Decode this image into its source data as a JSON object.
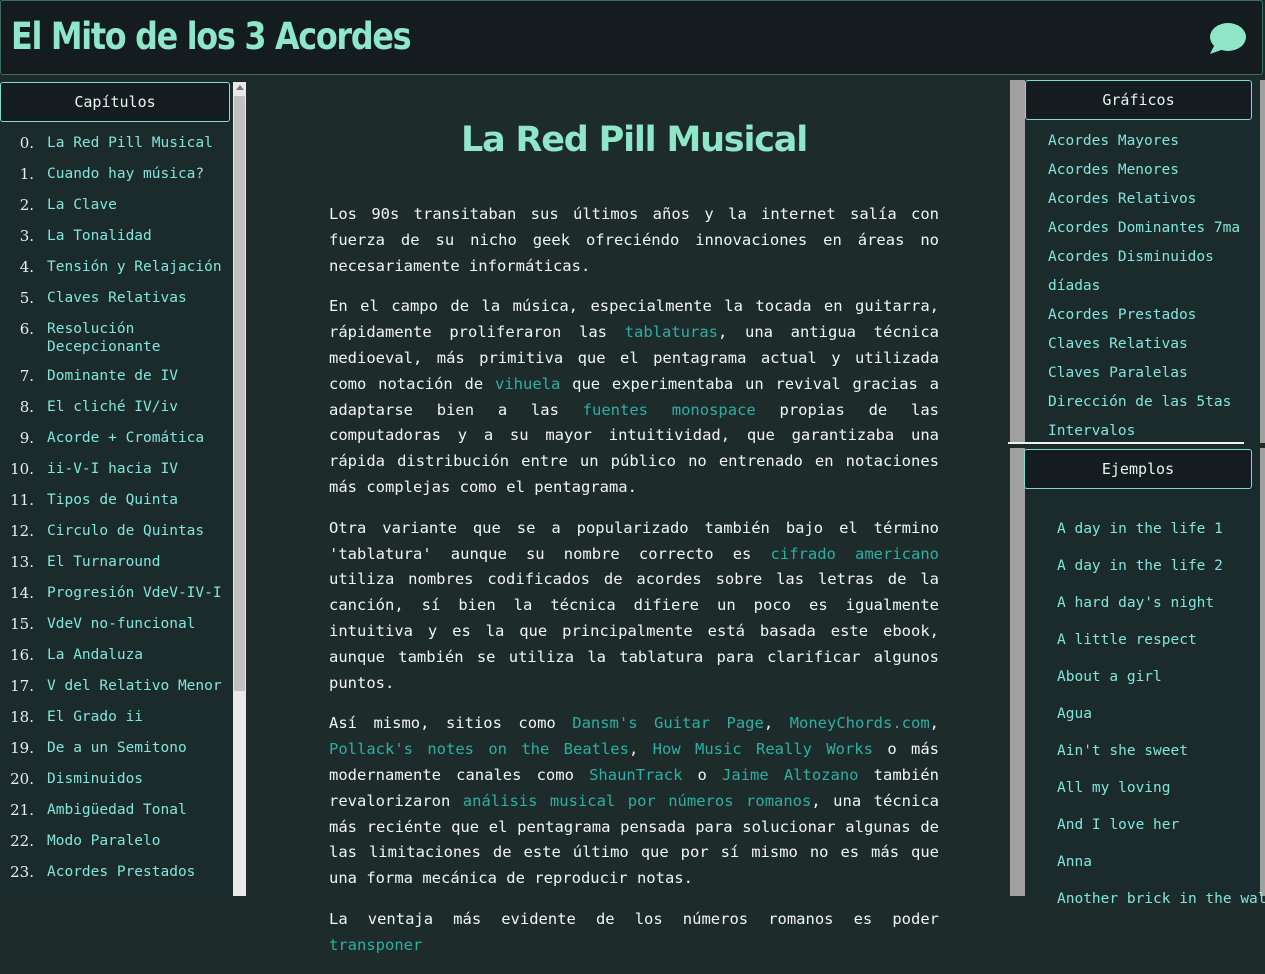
{
  "header": {
    "site_title": "El Mito de los 3 Acordes",
    "chat_icon": "speech-bubble-icon",
    "accent_color": "#8fe6c8"
  },
  "left_sidebar": {
    "title": "Capítulos",
    "chapters": [
      {
        "num": "0.",
        "label": "La Red Pill Musical"
      },
      {
        "num": "1.",
        "label": "Cuando hay música?"
      },
      {
        "num": "2.",
        "label": "La Clave"
      },
      {
        "num": "3.",
        "label": "La Tonalidad"
      },
      {
        "num": "4.",
        "label": "Tensión y Relajación"
      },
      {
        "num": "5.",
        "label": "Claves Relativas"
      },
      {
        "num": "6.",
        "label": "Resolución Decepcionante"
      },
      {
        "num": "7.",
        "label": "Dominante de IV"
      },
      {
        "num": "8.",
        "label": "El cliché IV/iv"
      },
      {
        "num": "9.",
        "label": "Acorde + Cromática"
      },
      {
        "num": "10.",
        "label": "ii-V-I hacia IV"
      },
      {
        "num": "11.",
        "label": "Tipos de Quinta"
      },
      {
        "num": "12.",
        "label": "Circulo de Quintas"
      },
      {
        "num": "13.",
        "label": "El Turnaround"
      },
      {
        "num": "14.",
        "label": "Progresión VdeV-IV-I"
      },
      {
        "num": "15.",
        "label": "VdeV no-funcional"
      },
      {
        "num": "16.",
        "label": "La Andaluza"
      },
      {
        "num": "17.",
        "label": "V del Relativo Menor"
      },
      {
        "num": "18.",
        "label": "El Grado ii"
      },
      {
        "num": "19.",
        "label": "De a un Semitono"
      },
      {
        "num": "20.",
        "label": "Disminuidos"
      },
      {
        "num": "21.",
        "label": "Ambigüedad Tonal"
      },
      {
        "num": "22.",
        "label": "Modo Paralelo"
      },
      {
        "num": "23.",
        "label": "Acordes Prestados"
      }
    ]
  },
  "main": {
    "page_title": "La Red Pill Musical",
    "paragraphs": [
      [
        {
          "text": "Los 90s transitaban sus últimos años y la internet salía con fuerza de su nicho geek ofreciéndo innovaciones en áreas no necesariamente informáticas."
        }
      ],
      [
        {
          "text": "En el campo de la música, especialmente la tocada en guitarra, rápidamente proliferaron las "
        },
        {
          "text": "tablaturas",
          "link": true
        },
        {
          "text": ", una antigua técnica medioeval, más primitiva que el pentagrama actual y utilizada como notación de "
        },
        {
          "text": "vihuela",
          "link": true
        },
        {
          "text": " que experimentaba un revival gracias a adaptarse bien a las "
        },
        {
          "text": "fuentes monospace",
          "link": true
        },
        {
          "text": " propias de las computadoras y a su mayor intuitividad, que garantizaba una rápida distribución entre un público no entrenado en notaciones más complejas como el pentagrama."
        }
      ],
      [
        {
          "text": "Otra variante que se a popularizado también bajo el término 'tablatura' aunque su nombre correcto es "
        },
        {
          "text": "cifrado americano",
          "link": true
        },
        {
          "text": " utiliza nombres codificados de acordes sobre las letras de la canción, sí bien la técnica difiere un poco es igualmente intuitiva y es la que principalmente está basada este ebook, aunque también se utiliza la tablatura para clarificar algunos puntos."
        }
      ],
      [
        {
          "text": "Así mismo, sitios como "
        },
        {
          "text": "Dansm's Guitar Page",
          "link": true
        },
        {
          "text": ", "
        },
        {
          "text": "MoneyChords.com",
          "link": true
        },
        {
          "text": ", "
        },
        {
          "text": "Pollack's notes on the Beatles",
          "link": true
        },
        {
          "text": ", "
        },
        {
          "text": "How Music Really Works",
          "link": true
        },
        {
          "text": " o más modernamente canales como "
        },
        {
          "text": "ShaunTrack",
          "link": true
        },
        {
          "text": " o "
        },
        {
          "text": "Jaime Altozano",
          "link": true
        },
        {
          "text": " también revalorizaron "
        },
        {
          "text": "análisis musical por números romanos",
          "link": true
        },
        {
          "text": ", una técnica más reciénte que el pentagrama pensada para solucionar algunas de las limitaciones de este último que por sí mismo no es más que una forma mecánica de reproducir notas."
        }
      ],
      [
        {
          "text": "La ventaja más evidente de los números romanos es poder "
        },
        {
          "text": "transponer",
          "link": true
        }
      ]
    ]
  },
  "graficos": {
    "title": "Gráficos",
    "items": [
      "Acordes Mayores",
      "Acordes Menores",
      "Acordes Relativos",
      "Acordes Dominantes 7ma",
      "Acordes Disminuidos",
      "díadas",
      "Acordes Prestados",
      "Claves Relativas",
      "Claves Paralelas",
      "Dirección de las 5tas",
      "Intervalos"
    ]
  },
  "ejemplos": {
    "title": "Ejemplos",
    "items": [
      "A day in the life 1",
      "A day in the life 2",
      "A hard day's night",
      "A little respect",
      "About a girl",
      "Agua",
      "Ain't she sweet",
      "All my loving",
      "And I love her",
      "Anna",
      "Another brick in the wall"
    ]
  }
}
